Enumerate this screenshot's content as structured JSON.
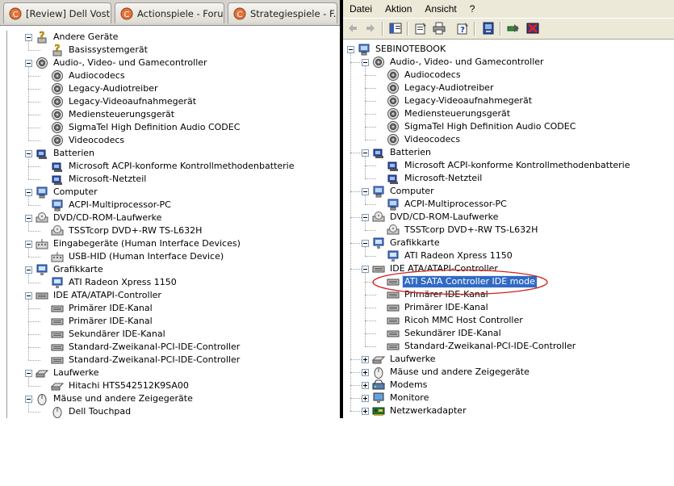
{
  "browser_tabs": [
    {
      "label": "[Review] Dell Vost..."
    },
    {
      "label": "Actionspiele - Foru..."
    },
    {
      "label": "Strategiespiele - F..."
    }
  ],
  "left_tree": [
    {
      "label": "Andere Geräte",
      "level": 0,
      "expander": "minus",
      "icon": "unknown-device-icon"
    },
    {
      "label": "Basissystemgerät",
      "level": 1,
      "icon": "unknown-device-icon"
    },
    {
      "label": "Audio-, Video- und Gamecontroller",
      "level": 0,
      "expander": "minus",
      "icon": "speaker-icon"
    },
    {
      "label": "Audiocodecs",
      "level": 1,
      "icon": "speaker-icon"
    },
    {
      "label": "Legacy-Audiotreiber",
      "level": 1,
      "icon": "speaker-icon"
    },
    {
      "label": "Legacy-Videoaufnahmegerät",
      "level": 1,
      "icon": "speaker-icon"
    },
    {
      "label": "Mediensteuerungsgerät",
      "level": 1,
      "icon": "speaker-icon"
    },
    {
      "label": "SigmaTel High Definition Audio CODEC",
      "level": 1,
      "icon": "speaker-icon"
    },
    {
      "label": "Videocodecs",
      "level": 1,
      "icon": "speaker-icon"
    },
    {
      "label": "Batterien",
      "level": 0,
      "expander": "minus",
      "icon": "battery-icon"
    },
    {
      "label": "Microsoft ACPI-konforme Kontrollmethodenbatterie",
      "level": 1,
      "icon": "battery-icon"
    },
    {
      "label": "Microsoft-Netzteil",
      "level": 1,
      "icon": "battery-icon"
    },
    {
      "label": "Computer",
      "level": 0,
      "expander": "minus",
      "icon": "computer-icon"
    },
    {
      "label": "ACPI-Multiprocessor-PC",
      "level": 1,
      "icon": "computer-icon"
    },
    {
      "label": "DVD/CD-ROM-Laufwerke",
      "level": 0,
      "expander": "minus",
      "icon": "cdrom-icon"
    },
    {
      "label": "TSSTcorp DVD+-RW TS-L632H",
      "level": 1,
      "icon": "cdrom-icon"
    },
    {
      "label": "Eingabegeräte (Human Interface Devices)",
      "level": 0,
      "expander": "minus",
      "icon": "hid-icon"
    },
    {
      "label": "USB-HID (Human Interface Device)",
      "level": 1,
      "icon": "hid-icon"
    },
    {
      "label": "Grafikkarte",
      "level": 0,
      "expander": "minus",
      "icon": "display-icon"
    },
    {
      "label": "ATI Radeon Xpress 1150",
      "level": 1,
      "icon": "display-icon"
    },
    {
      "label": "IDE ATA/ATAPI-Controller",
      "level": 0,
      "expander": "minus",
      "icon": "ide-icon"
    },
    {
      "label": "Primärer IDE-Kanal",
      "level": 1,
      "icon": "ide-icon"
    },
    {
      "label": "Primärer IDE-Kanal",
      "level": 1,
      "icon": "ide-icon"
    },
    {
      "label": "Sekundärer IDE-Kanal",
      "level": 1,
      "icon": "ide-icon"
    },
    {
      "label": "Standard-Zweikanal-PCI-IDE-Controller",
      "level": 1,
      "icon": "ide-icon"
    },
    {
      "label": "Standard-Zweikanal-PCI-IDE-Controller",
      "level": 1,
      "icon": "ide-icon"
    },
    {
      "label": "Laufwerke",
      "level": 0,
      "expander": "minus",
      "icon": "drive-icon"
    },
    {
      "label": "Hitachi HTS542512K9SA00",
      "level": 1,
      "icon": "drive-icon"
    },
    {
      "label": "Mäuse und andere Zeigegeräte",
      "level": 0,
      "expander": "minus",
      "icon": "mouse-icon"
    },
    {
      "label": "Dell Touchpad",
      "level": 1,
      "icon": "mouse-icon"
    }
  ],
  "menu": [
    "Datei",
    "Aktion",
    "Ansicht",
    "?"
  ],
  "toolbar_icons": [
    "back-icon",
    "forward-icon",
    "show-hide-tree-icon",
    "properties-icon",
    "print-icon",
    "help-icon",
    "scan-hardware-icon",
    "update-driver-icon",
    "uninstall-icon"
  ],
  "right_tree": [
    {
      "label": "SEBINOTEBOOK",
      "level": 0,
      "expander": "minus",
      "icon": "computer-icon"
    },
    {
      "label": "Audio-, Video- und Gamecontroller",
      "level": 1,
      "expander": "minus",
      "icon": "speaker-icon"
    },
    {
      "label": "Audiocodecs",
      "level": 2,
      "icon": "speaker-icon"
    },
    {
      "label": "Legacy-Audiotreiber",
      "level": 2,
      "icon": "speaker-icon"
    },
    {
      "label": "Legacy-Videoaufnahmegerät",
      "level": 2,
      "icon": "speaker-icon"
    },
    {
      "label": "Mediensteuerungsgerät",
      "level": 2,
      "icon": "speaker-icon"
    },
    {
      "label": "SigmaTel High Definition Audio CODEC",
      "level": 2,
      "icon": "speaker-icon"
    },
    {
      "label": "Videocodecs",
      "level": 2,
      "icon": "speaker-icon"
    },
    {
      "label": "Batterien",
      "level": 1,
      "expander": "minus",
      "icon": "battery-icon"
    },
    {
      "label": "Microsoft ACPI-konforme Kontrollmethodenbatterie",
      "level": 2,
      "icon": "battery-icon"
    },
    {
      "label": "Microsoft-Netzteil",
      "level": 2,
      "icon": "battery-icon"
    },
    {
      "label": "Computer",
      "level": 1,
      "expander": "minus",
      "icon": "computer-icon"
    },
    {
      "label": "ACPI-Multiprocessor-PC",
      "level": 2,
      "icon": "computer-icon"
    },
    {
      "label": "DVD/CD-ROM-Laufwerke",
      "level": 1,
      "expander": "minus",
      "icon": "cdrom-icon"
    },
    {
      "label": "TSSTcorp DVD+-RW TS-L632H",
      "level": 2,
      "icon": "cdrom-icon"
    },
    {
      "label": "Grafikkarte",
      "level": 1,
      "expander": "minus",
      "icon": "display-icon"
    },
    {
      "label": "ATI Radeon Xpress 1150",
      "level": 2,
      "icon": "display-icon"
    },
    {
      "label": "IDE ATA/ATAPI-Controller",
      "level": 1,
      "expander": "minus",
      "icon": "ide-icon"
    },
    {
      "label": "ATI SATA Controller IDE mode",
      "level": 2,
      "icon": "ide-icon",
      "selected": true
    },
    {
      "label": "Primärer IDE-Kanal",
      "level": 2,
      "icon": "ide-icon"
    },
    {
      "label": "Primärer IDE-Kanal",
      "level": 2,
      "icon": "ide-icon"
    },
    {
      "label": "Ricoh MMC Host Controller",
      "level": 2,
      "icon": "ide-icon"
    },
    {
      "label": "Sekundärer IDE-Kanal",
      "level": 2,
      "icon": "ide-icon"
    },
    {
      "label": "Standard-Zweikanal-PCI-IDE-Controller",
      "level": 2,
      "icon": "ide-icon"
    },
    {
      "label": "Laufwerke",
      "level": 1,
      "expander": "plus",
      "icon": "drive-icon"
    },
    {
      "label": "Mäuse und andere Zeigegeräte",
      "level": 1,
      "expander": "plus",
      "icon": "mouse-icon"
    },
    {
      "label": "Modems",
      "level": 1,
      "expander": "plus",
      "icon": "modem-icon"
    },
    {
      "label": "Monitore",
      "level": 1,
      "expander": "plus",
      "icon": "monitor-icon"
    },
    {
      "label": "Netzwerkadapter",
      "level": 1,
      "expander": "plus",
      "icon": "network-adapter-icon"
    }
  ],
  "colors": {
    "selection": "#316ac5",
    "annotation_ellipse": "#cc2222",
    "toolbar_bg": "#ece9d8"
  }
}
